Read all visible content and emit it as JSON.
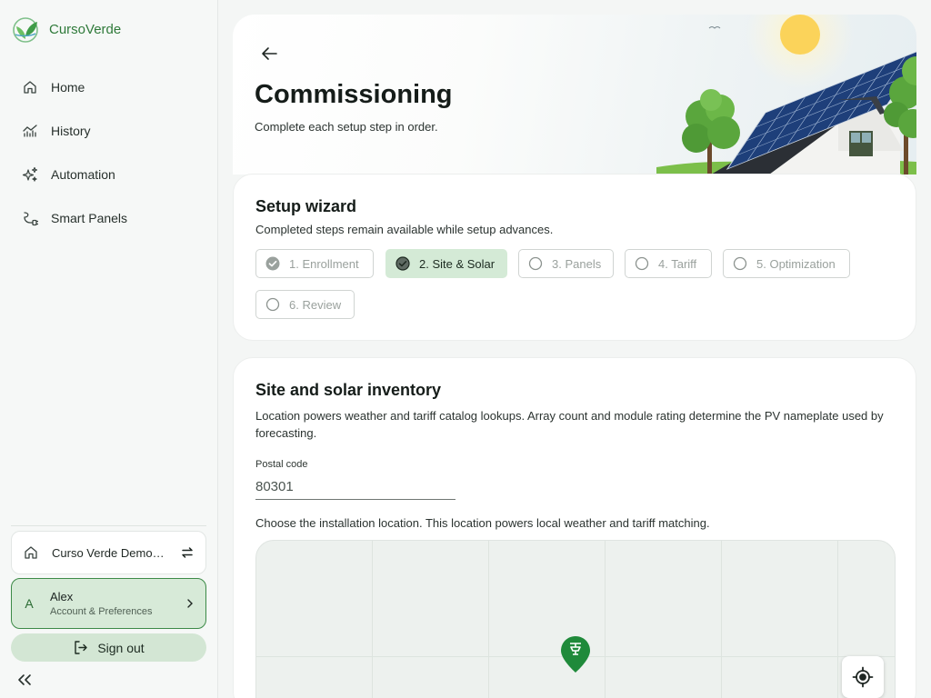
{
  "brand": {
    "name": "CursoVerde"
  },
  "nav": {
    "items": [
      {
        "label": "Home",
        "icon": "home-icon"
      },
      {
        "label": "History",
        "icon": "chart-icon"
      },
      {
        "label": "Automation",
        "icon": "sparkle-icon"
      },
      {
        "label": "Smart Panels",
        "icon": "plug-icon"
      }
    ]
  },
  "home_switcher": {
    "label": "Curso Verde Demo Home"
  },
  "account": {
    "avatar": "A",
    "name": "Alex",
    "subtitle": "Account & Preferences"
  },
  "signout": {
    "label": "Sign out"
  },
  "hero": {
    "title": "Commissioning",
    "subtitle": "Complete each setup step in order."
  },
  "wizard": {
    "title": "Setup wizard",
    "description": "Completed steps remain available while setup advances.",
    "steps": [
      {
        "label": "1. Enrollment",
        "state": "completed"
      },
      {
        "label": "2. Site & Solar",
        "state": "active"
      },
      {
        "label": "3. Panels",
        "state": "pending"
      },
      {
        "label": "4. Tariff",
        "state": "pending"
      },
      {
        "label": "5. Optimization",
        "state": "pending"
      },
      {
        "label": "6. Review",
        "state": "pending"
      }
    ]
  },
  "site": {
    "title": "Site and solar inventory",
    "description": "Location powers weather and tariff catalog lookups. Array count and module rating determine the PV nameplate used by forecasting.",
    "postal_label": "Postal code",
    "postal_value": "80301",
    "map_hint": "Choose the installation location. This location powers local weather and tariff matching."
  },
  "colors": {
    "accent": "#2f7a3a",
    "active_step": "#d4ead6",
    "account_bg": "#d7ead8",
    "marker": "#1f8a3a"
  }
}
